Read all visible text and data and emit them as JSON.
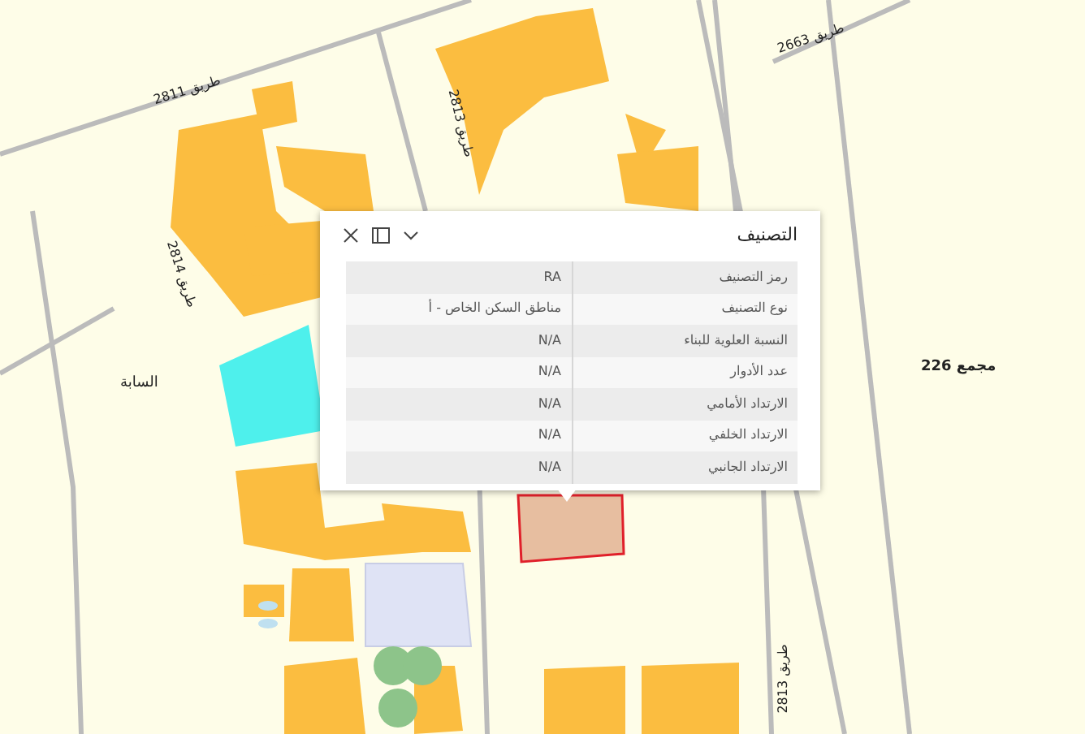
{
  "map": {
    "labels": [
      {
        "text": "طريق 2811",
        "kind": "road"
      },
      {
        "text": "طريق 2663",
        "kind": "road"
      },
      {
        "text": "طريق 2813",
        "kind": "road"
      },
      {
        "text": "طريق 2814",
        "kind": "road"
      },
      {
        "text": "السابة",
        "kind": "area"
      },
      {
        "text": "مجمع 226",
        "kind": "block"
      },
      {
        "text": "طريق 2813",
        "kind": "road"
      }
    ]
  },
  "popup": {
    "title": "التصنيف",
    "rows": [
      {
        "label": "رمز التصنيف",
        "value": "RA"
      },
      {
        "label": "نوع التصنيف",
        "value": "مناطق السكن الخاص - أ"
      },
      {
        "label": "النسبة العلوية للبناء",
        "value": "N/A"
      },
      {
        "label": "عدد الأدوار",
        "value": "N/A"
      },
      {
        "label": "الارتداد الأمامي",
        "value": "N/A"
      },
      {
        "label": "الارتداد الخلفي",
        "value": "N/A"
      },
      {
        "label": "الارتداد الجانبي",
        "value": "N/A"
      }
    ]
  }
}
